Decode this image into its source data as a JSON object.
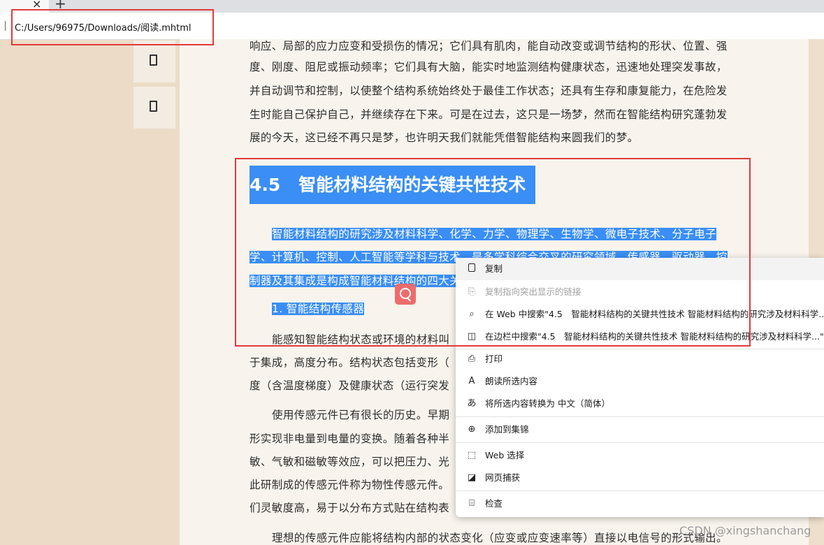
{
  "browser": {
    "tab_close": "×",
    "new_tab": "+",
    "address": "C:/Users/96975/Downloads/阅读.mhtml"
  },
  "article": {
    "lines_top": [
      "响应、局部的应力应变和受损伤的情况；它们具有肌肉，能自动改变或调节结构的形状、位置、强",
      "度、刚度、阻尼或振动频率；它们具有大脑，能实时地监测结构健康状态，迅速地处理突发事故，",
      "并自动调节和控制，以使整个结构系统始终处于最佳工作状态；还具有生存和康复能力，在危险发",
      "生时能自己保护自己，并继续存在下来。可是在过去，这只是一场梦，然而在智能结构研究蓬勃发",
      "展的今天，这已经不再只是梦，也许明天我们就能凭借智能结构来圆我们的梦。"
    ],
    "heading_num": "4.5",
    "heading_text": "智能材料结构的关键共性技术",
    "selected_lines": [
      "智能材料结构的研究涉及材料科学、化学、力学、物理学、生物学、微电子技术、分子电子",
      "学、计算机、控制、人工智能等学科与技术，是多学科综合交叉的研究领域。传感器、驱动器、控",
      "制器及其集成是构成智能材料结构的四大关键"
    ],
    "subheading": "1. 智能结构传感器",
    "lines_bottom": [
      "能感知智能结构状态或环境的材料叫",
      "于集成，高度分布。结构状态包括变形（",
      "度（含温度梯度）及健康状态（运行突发",
      "使用传感元件已有很长的历史。早期",
      "形实现非电量到电量的变换。随着各种半",
      "敏、气敏和磁敏等效应，可以把压力、光",
      "此研制成的传感元件称为物性传感元件。",
      "们灵敏度高，易于以分布方式贴在结构表",
      "理想的传感元件应能将结构内部的状态变化（应变或应变速率等）直接以电信号的形式输出。"
    ]
  },
  "context_menu": {
    "items": [
      {
        "icon": "▯",
        "label": "复制"
      },
      {
        "icon": "⎘",
        "label": "复制指向突出显示的链接"
      },
      {
        "icon": "⌕",
        "label": "在 Web 中搜索\"4.5　智能材料结构的关键共性技术  智能材料结构的研究涉及材料科学...\""
      },
      {
        "icon": "◫",
        "label": "在边栏中搜索\"4.5　智能材料结构的关键共性技术  智能材料结构的研究涉及材料科学...\""
      },
      {
        "icon": "⎙",
        "label": "打印"
      },
      {
        "icon": "A",
        "label": "朗读所选内容"
      },
      {
        "icon": "あ",
        "label": "将所选内容转换为 中文（简体）"
      },
      {
        "icon": "⊕",
        "label": "添加到集锦"
      },
      {
        "icon": "⬚",
        "label": "Web 选择"
      },
      {
        "icon": "◪",
        "label": "网页捕获"
      },
      {
        "icon": "⌸",
        "label": "检查"
      }
    ]
  },
  "watermark": "CSDN @xingshanchang"
}
